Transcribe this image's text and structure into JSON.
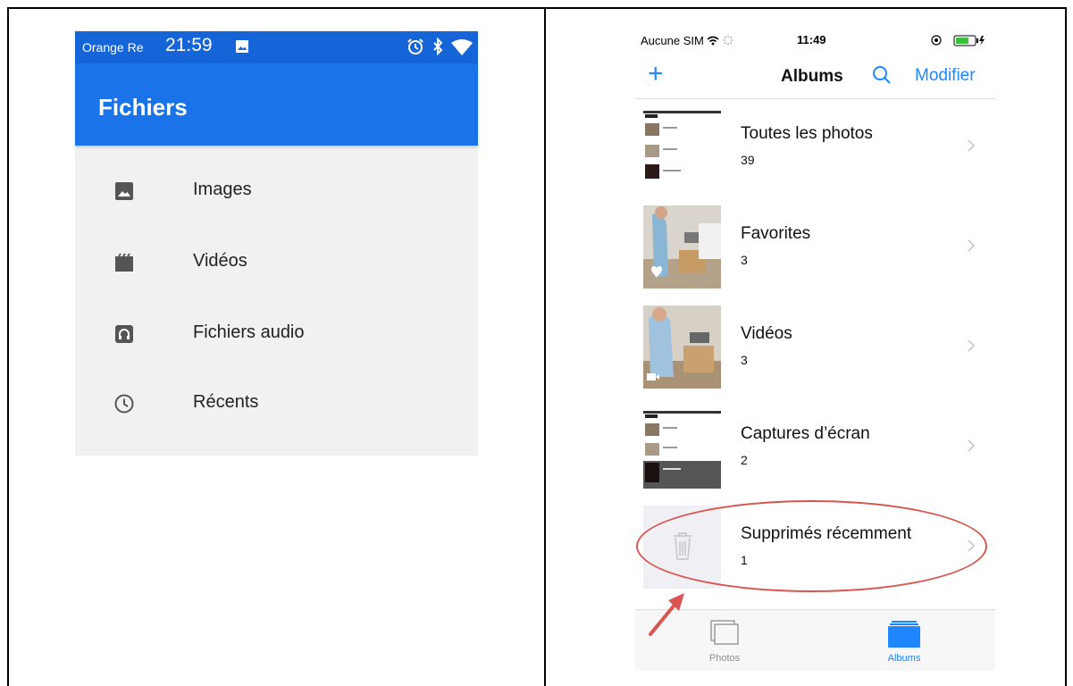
{
  "android": {
    "status": {
      "carrier": "Orange Re",
      "time": "21:59"
    },
    "app_title": "Fichiers",
    "items": [
      {
        "label": "Images",
        "icon": "image-icon"
      },
      {
        "label": "Vidéos",
        "icon": "video-clapper-icon"
      },
      {
        "label": "Fichiers audio",
        "icon": "headphones-icon"
      },
      {
        "label": "Récents",
        "icon": "clock-icon"
      }
    ],
    "colors": {
      "status_bar": "#1665d8",
      "app_bar": "#1a73e8",
      "background": "#f1f1f1"
    }
  },
  "ios": {
    "status": {
      "carrier": "Aucune SIM",
      "time": "11:49"
    },
    "nav": {
      "add": "+",
      "title": "Albums",
      "edit": "Modifier"
    },
    "albums": [
      {
        "name": "Toutes les photos",
        "count": "39"
      },
      {
        "name": "Favorites",
        "count": "3"
      },
      {
        "name": "Vidéos",
        "count": "3"
      },
      {
        "name": "Captures d’écran",
        "count": "2"
      },
      {
        "name": "Supprimés récemment",
        "count": "1"
      }
    ],
    "tabs": [
      {
        "label": "Photos",
        "active": false
      },
      {
        "label": "Albums",
        "active": true
      }
    ],
    "colors": {
      "tint": "#1f86ff",
      "highlight": "#d9534f"
    }
  }
}
